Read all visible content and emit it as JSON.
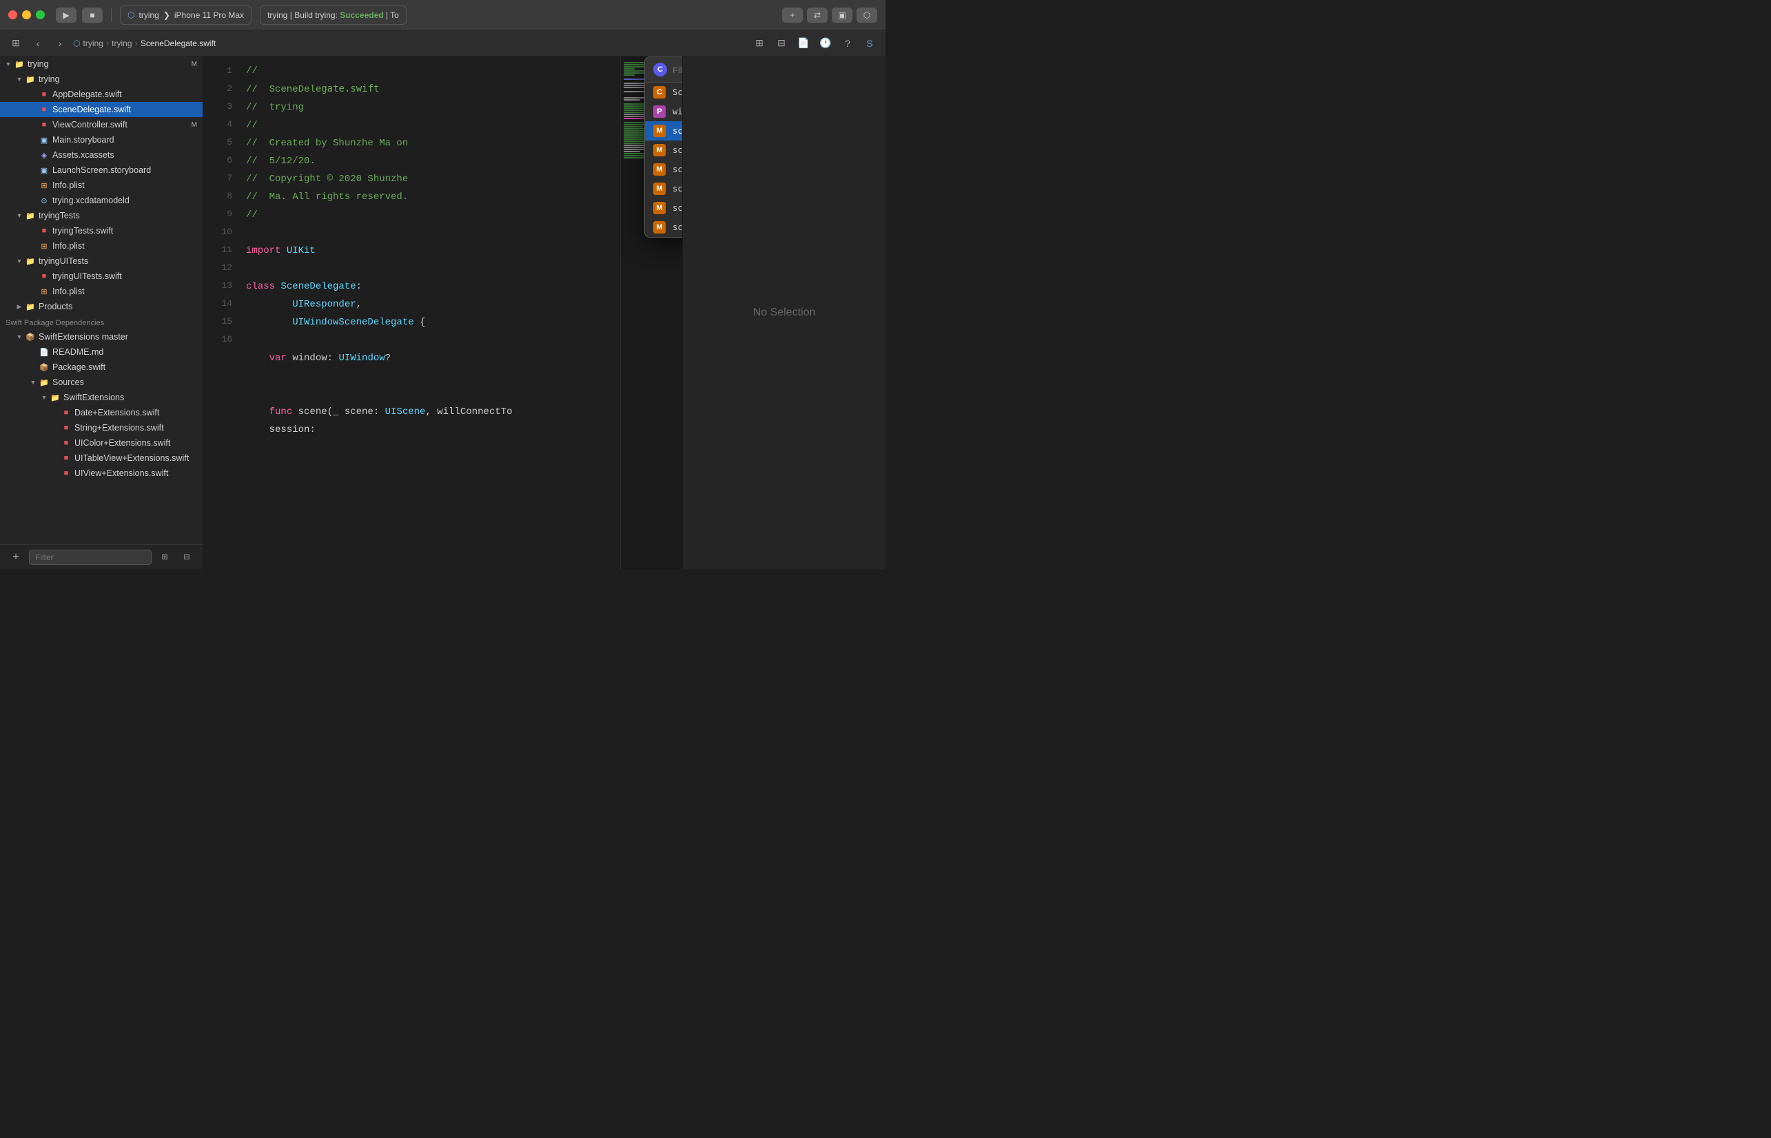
{
  "titlebar": {
    "project_name": "trying",
    "device": "iPhone 11 Pro Max",
    "build_status": "trying | Build trying: Succeeded | To",
    "breadcrumb": "trying ❯ trying ❯ SceneDelegate.s"
  },
  "toolbar": {
    "breadcrumb_parts": [
      "trying",
      "trying",
      "SceneDelegate.swift"
    ]
  },
  "sidebar": {
    "root_label": "trying",
    "root_badge": "M",
    "items": [
      {
        "id": "trying-folder",
        "label": "trying",
        "type": "folder",
        "level": 1,
        "expanded": true
      },
      {
        "id": "AppDelegate",
        "label": "AppDelegate.swift",
        "type": "swift",
        "level": 2
      },
      {
        "id": "SceneDelegate",
        "label": "SceneDelegate.swift",
        "type": "swift",
        "level": 2,
        "selected": true
      },
      {
        "id": "ViewController",
        "label": "ViewController.swift",
        "type": "swift",
        "level": 2,
        "badge": "M"
      },
      {
        "id": "Main-storyboard",
        "label": "Main.storyboard",
        "type": "storyboard",
        "level": 2
      },
      {
        "id": "Assets",
        "label": "Assets.xcassets",
        "type": "asset",
        "level": 2
      },
      {
        "id": "LaunchScreen",
        "label": "LaunchScreen.storyboard",
        "type": "storyboard",
        "level": 2
      },
      {
        "id": "Info-plist",
        "label": "Info.plist",
        "type": "plist",
        "level": 2
      },
      {
        "id": "datamodel",
        "label": "trying.xcdatamodeld",
        "type": "datamodel",
        "level": 2
      },
      {
        "id": "tryingTests-folder",
        "label": "tryingTests",
        "type": "folder",
        "level": 1,
        "expanded": true
      },
      {
        "id": "tryingTests-swift",
        "label": "tryingTests.swift",
        "type": "swift",
        "level": 2
      },
      {
        "id": "Info-plist2",
        "label": "Info.plist",
        "type": "plist",
        "level": 2
      },
      {
        "id": "tryingUITests-folder",
        "label": "tryingUITests",
        "type": "folder",
        "level": 1,
        "expanded": true
      },
      {
        "id": "tryingUITests-swift",
        "label": "tryingUITests.swift",
        "type": "swift",
        "level": 2
      },
      {
        "id": "Info-plist3",
        "label": "Info.plist",
        "type": "plist",
        "level": 2
      },
      {
        "id": "Products-folder",
        "label": "Products",
        "type": "folder",
        "level": 1,
        "expanded": false
      },
      {
        "id": "swift-pkg-deps",
        "label": "Swift Package Dependencies",
        "type": "section",
        "level": 0
      },
      {
        "id": "SwiftExtensions-folder",
        "label": "SwiftExtensions master",
        "type": "folder",
        "level": 1,
        "expanded": true
      },
      {
        "id": "README",
        "label": "README.md",
        "type": "markdown",
        "level": 2
      },
      {
        "id": "Package-swift",
        "label": "Package.swift",
        "type": "package",
        "level": 2
      },
      {
        "id": "Sources-folder",
        "label": "Sources",
        "type": "folder",
        "level": 2,
        "expanded": true
      },
      {
        "id": "SwiftExtensions-sub",
        "label": "SwiftExtensions",
        "type": "folder",
        "level": 3,
        "expanded": true
      },
      {
        "id": "Date-ext",
        "label": "Date+Extensions.swift",
        "type": "swift",
        "level": 4
      },
      {
        "id": "String-ext",
        "label": "String+Extensions.swift",
        "type": "swift",
        "level": 4
      },
      {
        "id": "UIColor-ext",
        "label": "UIColor+Extensions.swift",
        "type": "swift",
        "level": 4
      },
      {
        "id": "UITableView-ext",
        "label": "UITableView+Extensions.swift",
        "type": "swift",
        "level": 4
      },
      {
        "id": "UIView-ext",
        "label": "UIView+Extensions.swift",
        "type": "swift",
        "level": 4
      }
    ],
    "filter_placeholder": "Filter"
  },
  "editor": {
    "filename": "SceneDelegate.swift",
    "lines": [
      {
        "num": 1,
        "tokens": [
          {
            "t": "comment",
            "v": "//"
          }
        ]
      },
      {
        "num": 2,
        "tokens": [
          {
            "t": "comment",
            "v": "//  SceneDelegate.swift"
          }
        ]
      },
      {
        "num": 3,
        "tokens": [
          {
            "t": "comment",
            "v": "//  trying"
          }
        ]
      },
      {
        "num": 4,
        "tokens": [
          {
            "t": "comment",
            "v": "//"
          }
        ]
      },
      {
        "num": 5,
        "tokens": [
          {
            "t": "comment",
            "v": "//  Created by Shunzhe Ma on 5/12/20."
          }
        ]
      },
      {
        "num": 6,
        "tokens": [
          {
            "t": "comment",
            "v": "//  Copyright © 2020 Shunzhe Ma. All rights reserved."
          }
        ]
      },
      {
        "num": 7,
        "tokens": [
          {
            "t": "comment",
            "v": "//"
          }
        ]
      },
      {
        "num": 8,
        "tokens": []
      },
      {
        "num": 9,
        "tokens": [
          {
            "t": "kw",
            "v": "import"
          },
          {
            "t": "plain",
            "v": " "
          },
          {
            "t": "type",
            "v": "UIKit"
          }
        ]
      },
      {
        "num": 10,
        "tokens": []
      },
      {
        "num": 11,
        "tokens": [
          {
            "t": "kw",
            "v": "class"
          },
          {
            "t": "plain",
            "v": " "
          },
          {
            "t": "type",
            "v": "SceneDelegate"
          },
          {
            "t": "plain",
            "v": ":"
          }
        ]
      },
      {
        "num": 11,
        "tokens": [
          {
            "t": "plain",
            "v": "        "
          },
          {
            "t": "type",
            "v": "UIResponder"
          },
          {
            "t": "plain",
            "v": ","
          }
        ]
      },
      {
        "num": 11,
        "tokens": [
          {
            "t": "plain",
            "v": "        "
          },
          {
            "t": "type",
            "v": "UIWindowSceneDelegate"
          },
          {
            "t": "plain",
            "v": " {"
          }
        ]
      },
      {
        "num": 12,
        "tokens": []
      },
      {
        "num": 13,
        "tokens": [
          {
            "t": "plain",
            "v": "    "
          },
          {
            "t": "kw",
            "v": "var"
          },
          {
            "t": "plain",
            "v": " window: "
          },
          {
            "t": "type",
            "v": "UIWindow"
          },
          {
            "t": "plain",
            "v": "?"
          }
        ]
      },
      {
        "num": 14,
        "tokens": []
      },
      {
        "num": 15,
        "tokens": []
      },
      {
        "num": 16,
        "tokens": [
          {
            "t": "plain",
            "v": "    "
          },
          {
            "t": "kw",
            "v": "func"
          },
          {
            "t": "plain",
            "v": " scene(_ scene: "
          },
          {
            "t": "type",
            "v": "UIScene"
          },
          {
            "t": "plain",
            "v": ", willConnectTo"
          }
        ]
      },
      {
        "num": 16,
        "tokens": [
          {
            "t": "plain",
            "v": "    session:"
          }
        ]
      }
    ]
  },
  "autocomplete": {
    "filter_placeholder": "Filter",
    "header_icon": "C",
    "header_label": "SceneDelegate",
    "items": [
      {
        "id": "window",
        "badge": "P",
        "badge_type": "p",
        "label": "window",
        "selected": false
      },
      {
        "id": "scene-willconnect",
        "badge": "M",
        "badge_type": "m",
        "label": "scene(_:willConnectTo:options:)",
        "selected": true
      },
      {
        "id": "sceneDidDisconnect",
        "badge": "M",
        "badge_type": "m",
        "label": "sceneDidDisconnect(_:)",
        "selected": false
      },
      {
        "id": "sceneDidBecomeActive",
        "badge": "M",
        "badge_type": "m",
        "label": "sceneDidBecomeActive(_:)",
        "selected": false
      },
      {
        "id": "sceneWillResignActive",
        "badge": "M",
        "badge_type": "m",
        "label": "sceneWillResignActive(_:)",
        "selected": false
      },
      {
        "id": "sceneWillEnterForeground",
        "badge": "M",
        "badge_type": "m",
        "label": "sceneWillEnterForeground(_:)",
        "selected": false
      },
      {
        "id": "sceneDidEnterBackground",
        "badge": "M",
        "badge_type": "m",
        "label": "sceneDidEnterBackground(_:)",
        "selected": false
      }
    ]
  },
  "right_panel": {
    "no_selection": "No Selection"
  },
  "line_numbers": [
    1,
    2,
    3,
    4,
    5,
    6,
    7,
    8,
    9,
    10,
    11,
    12,
    13,
    14,
    15,
    16
  ]
}
